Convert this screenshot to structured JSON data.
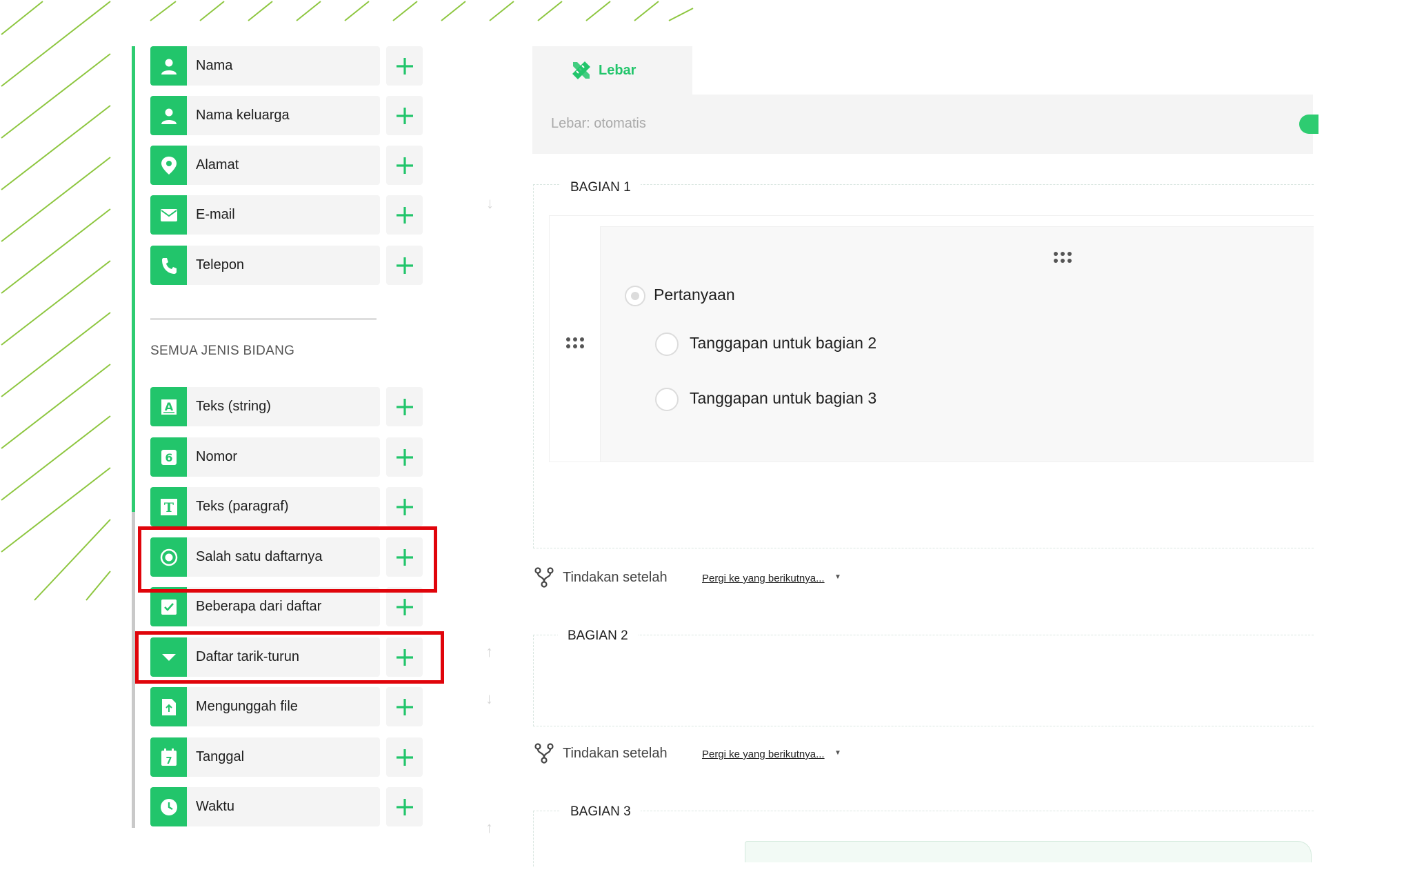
{
  "sidebar": {
    "top_fields": [
      {
        "label": "Nama",
        "icon": "person-icon"
      },
      {
        "label": "Nama keluarga",
        "icon": "person-icon"
      },
      {
        "label": "Alamat",
        "icon": "location-pin-icon"
      },
      {
        "label": "E-mail",
        "icon": "envelope-icon"
      },
      {
        "label": "Telepon",
        "icon": "phone-icon"
      }
    ],
    "section_title": "SEMUA JENIS BIDANG",
    "all_fields": [
      {
        "label": "Teks (string)",
        "icon": "text-string-icon",
        "glyph": "A"
      },
      {
        "label": "Nomor",
        "icon": "number-icon",
        "glyph": "6"
      },
      {
        "label": "Teks (paragraf)",
        "icon": "text-paragraph-icon",
        "glyph": "T"
      },
      {
        "label": "Salah satu daftarnya",
        "icon": "radio-icon"
      },
      {
        "label": "Beberapa dari daftar",
        "icon": "checkbox-icon"
      },
      {
        "label": "Daftar tarik-turun",
        "icon": "dropdown-icon"
      },
      {
        "label": "Mengunggah file",
        "icon": "upload-file-icon"
      },
      {
        "label": "Tanggal",
        "icon": "calendar-icon",
        "glyph": "7"
      },
      {
        "label": "Waktu",
        "icon": "clock-icon"
      }
    ]
  },
  "settings": {
    "tab_label": "Lebar",
    "width_text": "Lebar: otomatis"
  },
  "sections": [
    {
      "label": "BAGIAN 1"
    },
    {
      "label": "BAGIAN 2"
    },
    {
      "label": "BAGIAN 3"
    }
  ],
  "question": {
    "title": "Pertanyaan",
    "options": [
      "Tanggapan untuk bagian 2",
      "Tanggapan untuk bagian 3"
    ]
  },
  "actions": [
    {
      "label": "Tindakan setelah",
      "link": "Pergi ke yang berikutnya..."
    },
    {
      "label": "Tindakan setelah",
      "link": "Pergi ke yang berikutnya..."
    }
  ],
  "colors": {
    "accent": "#22c56b",
    "highlight": "#e0040b"
  }
}
